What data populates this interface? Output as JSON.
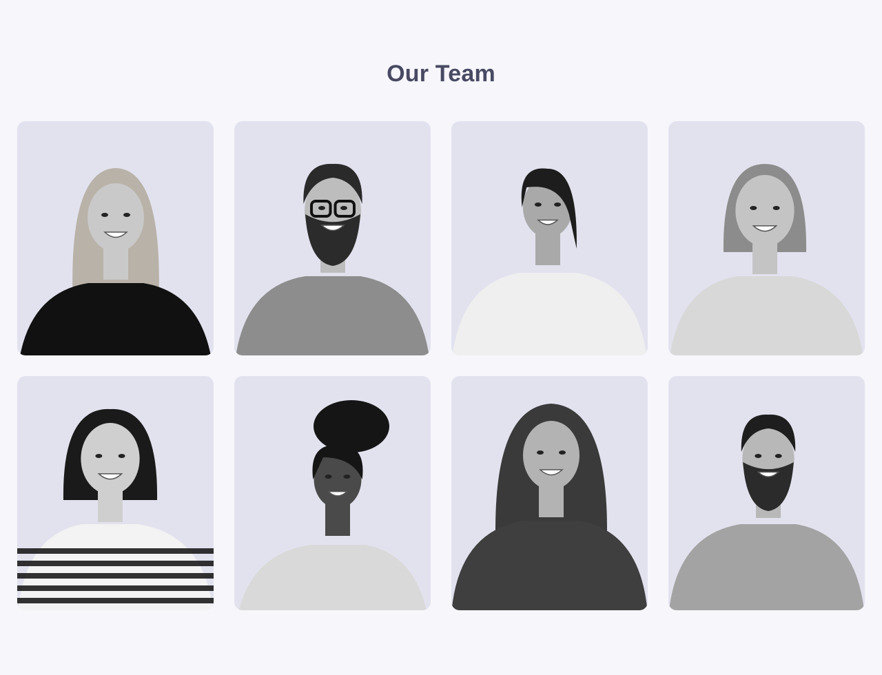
{
  "page": {
    "title": "Our Team"
  },
  "colors": {
    "background": "#f6f6fb",
    "card_background": "#e2e2ef",
    "title": "#484a63"
  },
  "team": {
    "members": [
      {
        "portrait": "woman-blonde-wavy-hair-black-top",
        "tone": "#c9c9c9",
        "hair": "#b9b2a8",
        "shirt": "#111111"
      },
      {
        "portrait": "man-beard-glasses-denim-shirt",
        "tone": "#bdbdbd",
        "hair": "#2a2a2a",
        "shirt": "#8d8d8d"
      },
      {
        "portrait": "woman-dark-ponytail-white-patterned-top",
        "tone": "#a9a9a9",
        "hair": "#1d1d1d",
        "shirt": "#efefef"
      },
      {
        "portrait": "woman-short-light-hair-light-top",
        "tone": "#c4c4c4",
        "hair": "#8c8c8c",
        "shirt": "#d8d8d8"
      },
      {
        "portrait": "woman-short-bob-striped-shirt",
        "tone": "#cfcfcf",
        "hair": "#1a1a1a",
        "shirt": "#f3f3f3"
      },
      {
        "portrait": "woman-braided-updo-light-sweater",
        "tone": "#4a4a4a",
        "hair": "#151515",
        "shirt": "#d9d9d9"
      },
      {
        "portrait": "woman-curly-hair-patterned-tank",
        "tone": "#b3b3b3",
        "hair": "#3a3a3a",
        "shirt": "#3f3f3f"
      },
      {
        "portrait": "man-beard-denim-shirt",
        "tone": "#b8b8b8",
        "hair": "#1e1e1e",
        "shirt": "#a3a3a3"
      }
    ]
  }
}
